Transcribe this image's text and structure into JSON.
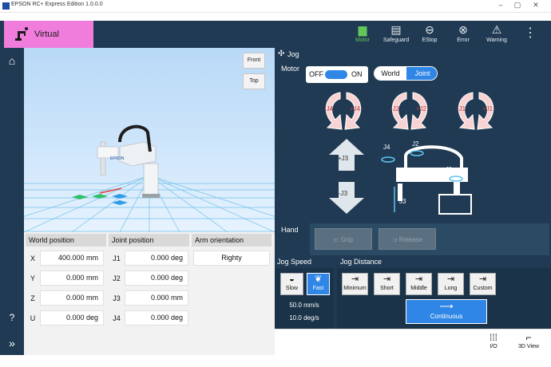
{
  "window": {
    "title": "EPSON RC+ Express Edition 1.0.0.0"
  },
  "header": {
    "mode": "Virtual",
    "buttons": [
      {
        "label": "Motor",
        "icon": "motor-icon"
      },
      {
        "label": "Safeguard",
        "icon": "safeguard-icon"
      },
      {
        "label": "EStop",
        "icon": "estop-icon"
      },
      {
        "label": "Error",
        "icon": "error-icon"
      },
      {
        "label": "Warning",
        "icon": "warning-icon"
      }
    ],
    "colors": {
      "bar": "#1f3a52",
      "mode_tab": "#f07ddc",
      "active": "#61c75a"
    }
  },
  "view3d": {
    "front_label": "Front",
    "top_label": "Top",
    "robot_brand": "EPSON"
  },
  "positions": {
    "world_header": "World position",
    "joint_header": "Joint position",
    "arm_header": "Arm orientation",
    "world": [
      {
        "axis": "X",
        "value": "400.000 mm"
      },
      {
        "axis": "Y",
        "value": "0.000 mm"
      },
      {
        "axis": "Z",
        "value": "0.000 mm"
      },
      {
        "axis": "U",
        "value": "0.000 deg"
      }
    ],
    "joint": [
      {
        "axis": "J1",
        "value": "0.000 deg"
      },
      {
        "axis": "J2",
        "value": "0.000 deg"
      },
      {
        "axis": "J3",
        "value": "0.000 mm"
      },
      {
        "axis": "J4",
        "value": "0.000 deg"
      }
    ],
    "arm_orientation": "Righty"
  },
  "jog": {
    "title": "Jog",
    "motor_label": "Motor",
    "motor_off": "OFF",
    "motor_on": "ON",
    "frame_world": "World",
    "frame_joint": "Joint",
    "rotation_pairs": [
      {
        "minus": "-J4",
        "plus": "+J4"
      },
      {
        "minus": "-J2",
        "plus": "+J2"
      },
      {
        "minus": "-J1",
        "plus": "+J1"
      }
    ],
    "j3_plus": "+J3",
    "j3_minus": "-J3",
    "diagram_labels": {
      "j4": "J4",
      "j2": "J2",
      "j1": "J1",
      "j3": "J3"
    },
    "hand_label": "Hand",
    "grip_label": "Grip",
    "release_label": "Release"
  },
  "speed": {
    "title": "Jog Speed",
    "slow": "Slow",
    "fast": "Fast",
    "linear": "50.0 mm/s",
    "angular": "10.0 deg/s"
  },
  "distance": {
    "title": "Jog Distance",
    "options": [
      "Minimum",
      "Short",
      "Middle",
      "Long",
      "Custom"
    ],
    "continuous": "Continuous"
  },
  "bottom": {
    "io_label": "I/O",
    "view_label": "3D View"
  }
}
